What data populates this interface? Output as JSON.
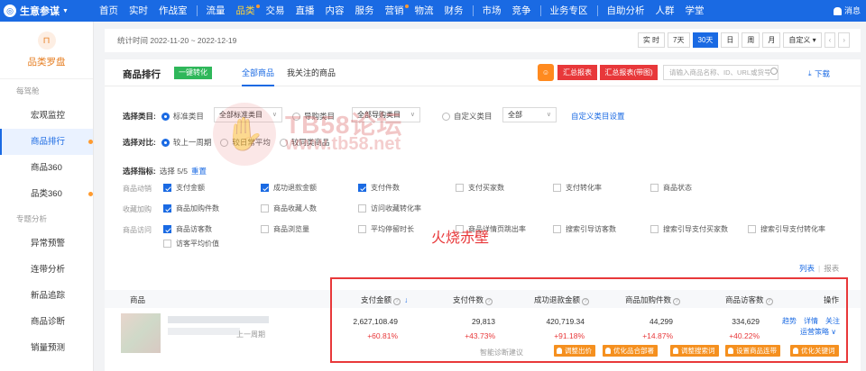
{
  "app": {
    "name": "生意参谋"
  },
  "nav": {
    "items": [
      "首页",
      "实时",
      "作战室",
      "流量",
      "品类",
      "交易",
      "直播",
      "内容",
      "服务",
      "营销",
      "物流",
      "财务",
      "市场",
      "竞争",
      "业务专区",
      "自助分析",
      "人群",
      "学堂"
    ],
    "active": "品类",
    "message": "消息"
  },
  "sidebar": {
    "title": "品类罗盘",
    "groups": [
      {
        "label": "每驾舱",
        "items": [
          "宏观监控",
          "商品排行",
          "商品360",
          "品类360"
        ]
      },
      {
        "label": "专题分析",
        "items": [
          "异常预警",
          "连带分析",
          "新品追踪",
          "商品诊断",
          "销量预测"
        ]
      }
    ],
    "active": "商品排行"
  },
  "datebar": {
    "text": "统计时间 2022-11-20 ~ 2022-12-19",
    "buttons": [
      "实 时",
      "7天",
      "30天",
      "日",
      "周",
      "月",
      "自定义"
    ],
    "active": "30天"
  },
  "panel": {
    "title": "商品排行",
    "one_key": "一键转化",
    "tabs": [
      "全部商品",
      "我关注的商品"
    ],
    "active_tab": "全部商品",
    "report_btn": "汇总报表",
    "report_btn2": "汇总报表(带图)",
    "search_placeholder": "请输入商品名称、ID、URL或货号",
    "download": "下载"
  },
  "filters": {
    "category_label": "选择类目:",
    "opt_standard": "标准类目",
    "sel_standard": "全部标准类目",
    "opt_guide": "导购类目",
    "sel_guide": "全部导购类目",
    "opt_custom": "自定义类目",
    "sel_custom": "全部",
    "custom_setting": "自定义类目设置",
    "compare_label": "选择对比:",
    "cmp_prev": "较上一周期",
    "cmp_avg": "较日常平均",
    "cmp_similar": "较同类商品",
    "metric_label": "选择指标:",
    "metric_count": "选择 5/5",
    "reset": "重置"
  },
  "metrics": {
    "groups": [
      "商品动销",
      "收藏加购",
      "商品访问"
    ],
    "row1": [
      {
        "label": "支付金额",
        "on": true
      },
      {
        "label": "成功退款金额",
        "on": true
      },
      {
        "label": "支付件数",
        "on": true
      },
      {
        "label": "支付买家数",
        "on": false
      },
      {
        "label": "支付转化率",
        "on": false
      },
      {
        "label": "商品状态",
        "on": false
      }
    ],
    "row2": [
      {
        "label": "商品加购件数",
        "on": true
      },
      {
        "label": "商品收藏人数",
        "on": false
      },
      {
        "label": "访问收藏转化率",
        "on": false
      }
    ],
    "row3": [
      {
        "label": "商品访客数",
        "on": true
      },
      {
        "label": "商品浏览量",
        "on": false
      },
      {
        "label": "平均停留时长",
        "on": false
      },
      {
        "label": "商品详情页跳出率",
        "on": false
      },
      {
        "label": "搜索引导访客数",
        "on": false
      },
      {
        "label": "搜索引导支付买家数",
        "on": false
      },
      {
        "label": "搜索引导支付转化率",
        "on": false
      }
    ],
    "row4": [
      {
        "label": "访客平均价值",
        "on": false
      }
    ]
  },
  "watermark": {
    "title": "TB58论坛",
    "url": "www.tb58.net",
    "logo": "✋"
  },
  "annotation": "火烧赤壁",
  "view": {
    "list": "列表",
    "chart": "报表"
  },
  "table": {
    "headers": {
      "product": "商品",
      "pay_amount": "支付金额",
      "pay_qty": "支付件数",
      "refund_amount": "成功退款金额",
      "cart_qty": "商品加购件数",
      "visitors": "商品访客数",
      "ops": "操作"
    },
    "row": {
      "period": "上一周期",
      "pay_amount": "2,627,108.49",
      "pay_amount_pct": "+60.81%",
      "pay_qty": "29,813",
      "pay_qty_pct": "+43.73%",
      "refund_amount": "420,719.34",
      "refund_amount_pct": "+91.18%",
      "cart_qty": "44,299",
      "cart_qty_pct": "+14.87%",
      "visitors": "334,629",
      "visitors_pct": "+40.22%",
      "op_trend": "趋势",
      "op_detail": "详情",
      "op_follow": "关注",
      "op_strategy": "运营策略"
    },
    "suggest_label": "智能诊断建议",
    "suggest_btns": [
      "调整出价",
      "优化品合部署",
      "调整搜索词",
      "设置商品连带",
      "优化关键词"
    ]
  }
}
